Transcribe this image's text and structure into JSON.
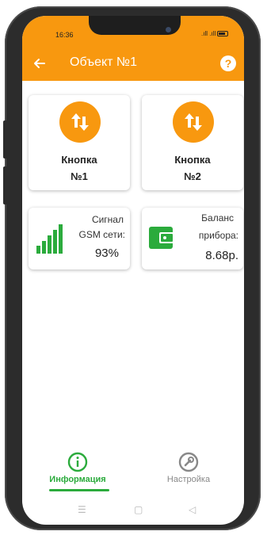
{
  "status_bar": {
    "time": "16:36",
    "signal_text": ".ıll .ıll"
  },
  "header": {
    "title": "Объект №1",
    "help_label": "?"
  },
  "buttons": [
    {
      "line1": "Кнопка",
      "line2": "№1"
    },
    {
      "line1": "Кнопка",
      "line2": "№2"
    }
  ],
  "signal": {
    "line1": "Сигнал",
    "line2": "GSM сети:",
    "value": "93%"
  },
  "balance": {
    "line1": "Баланс",
    "line2": "прибора:",
    "value": "8.68р."
  },
  "bottom_nav": {
    "items": [
      {
        "label": "Информация",
        "active": true
      },
      {
        "label": "Настройка",
        "active": false
      }
    ]
  },
  "system_nav": {
    "menu": "☰",
    "home": "▢",
    "back": "◁"
  },
  "colors": {
    "accent": "#f8980f",
    "green": "#2bab3c",
    "inactive": "#888888"
  }
}
